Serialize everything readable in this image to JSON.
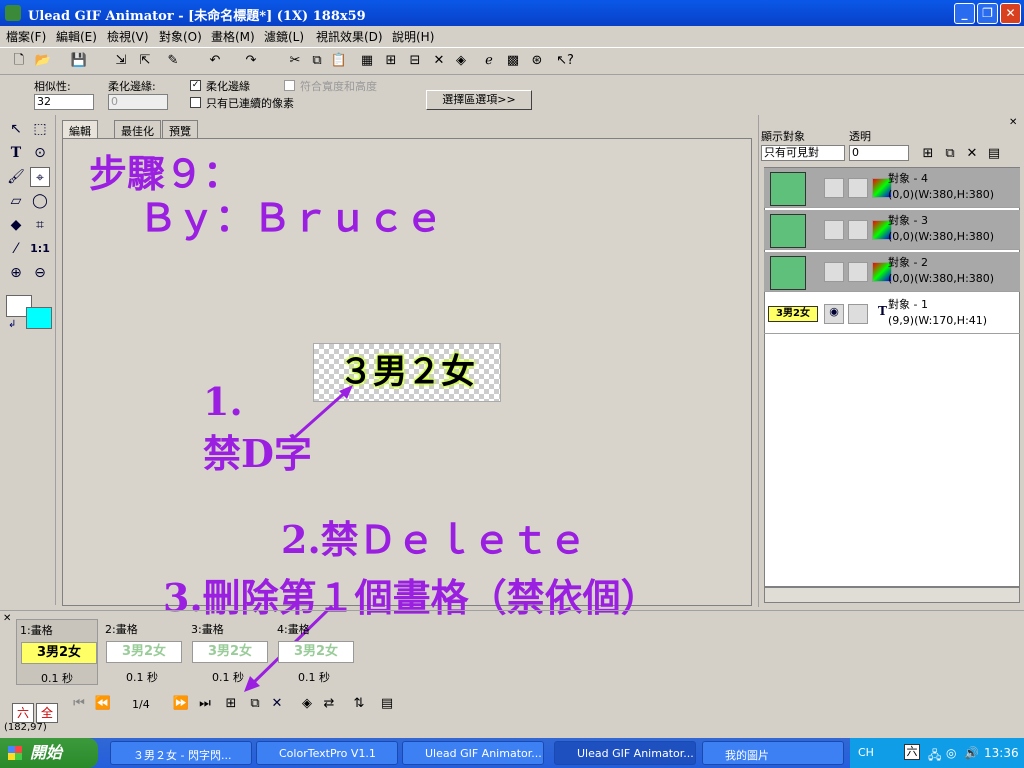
{
  "window": {
    "title": "Ulead GIF Animator - [未命名標題*] (1X) 188x59",
    "minimize": "_",
    "restore": "❐",
    "close": "✕"
  },
  "menu": [
    "檔案(F)",
    "編輯(E)",
    "檢視(V)",
    "對象(O)",
    "畫格(M)",
    "濾鏡(L)",
    "視訊效果(D)",
    "說明(H)"
  ],
  "props": {
    "similarity_label": "相似性:",
    "similarity_value": "32",
    "feather_label": "柔化邊緣:",
    "feather_value": "0",
    "antialias_label": "柔化邊緣",
    "fit_label": "符合寬度和高度",
    "contiguous_label": "只有已連續的像素",
    "select_options_button": "選擇區選項>>"
  },
  "tabs": [
    "編輯",
    "最佳化",
    "預覽"
  ],
  "canvas": {
    "step_text": "步驟９：",
    "author_text": "Ｂｙ：Ｂｒｕｃｅ",
    "image_text": "３男２女",
    "note1_line1": "1.",
    "note1_line2": "禁D字",
    "note2": "2.禁Ｄｅｌｅｔｅ",
    "note3": "3.刪除第１個畫格（禁依個）"
  },
  "objects": {
    "show_label": "顯示對象",
    "opacity_label": "透明",
    "filter_value": "只有可見對",
    "opacity_value": "0",
    "items": [
      {
        "name": "對象 - 4",
        "info": "(0,0)(W:380,H:380)",
        "thumb": ""
      },
      {
        "name": "對象 - 3",
        "info": "(0,0)(W:380,H:380)",
        "thumb": ""
      },
      {
        "name": "對象 - 2",
        "info": "(0,0)(W:380,H:380)",
        "thumb": ""
      },
      {
        "name": "對象 - 1",
        "info": "(9,9)(W:170,H:41)",
        "thumb": "3男2女"
      }
    ]
  },
  "frames": [
    {
      "label": "1:畫格",
      "delay": "0.1 秒",
      "thumb": "3男2女"
    },
    {
      "label": "2:畫格",
      "delay": "0.1 秒",
      "thumb": "3男2女"
    },
    {
      "label": "3:畫格",
      "delay": "0.1 秒",
      "thumb": "3男2女"
    },
    {
      "label": "4:畫格",
      "delay": "0.1 秒",
      "thumb": "3男2女"
    }
  ],
  "frame_counter": "1/4",
  "ime": {
    "mode1": "六",
    "mode2": "全"
  },
  "status": {
    "coords": "(182,97)"
  },
  "taskbar": {
    "start": "開始",
    "tasks": [
      "３男２女 - 閃字閃...",
      "ColorTextPro V1.1",
      "Ulead GIF Animator...",
      "Ulead GIF Animator...",
      "我的圖片"
    ],
    "lang": "CH",
    "ime": "六",
    "time": "13:36"
  },
  "colors": {
    "accent": "#0a58e8",
    "purple_text": "#9b1fe0",
    "background_color": "#00ffff"
  }
}
